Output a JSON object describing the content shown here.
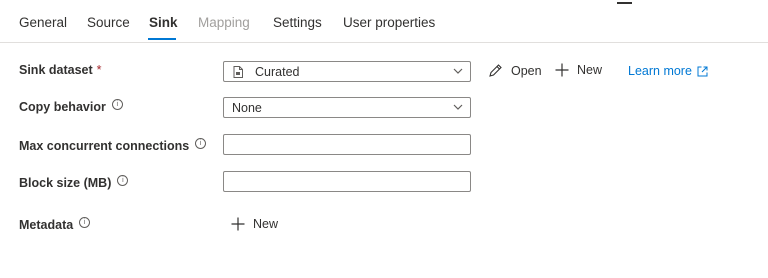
{
  "tabs": [
    {
      "label": "General"
    },
    {
      "label": "Source"
    },
    {
      "label": "Sink"
    },
    {
      "label": "Mapping"
    },
    {
      "label": "Settings"
    },
    {
      "label": "User properties"
    }
  ],
  "form": {
    "sink_dataset": {
      "label": "Sink dataset",
      "required_mark": "*",
      "value": "Curated"
    },
    "copy_behavior": {
      "label": "Copy behavior",
      "value": "None"
    },
    "max_concurrent_connections": {
      "label": "Max concurrent connections",
      "value": ""
    },
    "block_size": {
      "label": "Block size (MB)",
      "value": ""
    },
    "metadata": {
      "label": "Metadata"
    }
  },
  "actions": {
    "open_label": "Open",
    "new_label": "New",
    "learn_more_label": "Learn more",
    "metadata_new_label": "New"
  },
  "colors": {
    "accent": "#0078d4",
    "border": "#8a8886",
    "required": "#a4262c"
  }
}
